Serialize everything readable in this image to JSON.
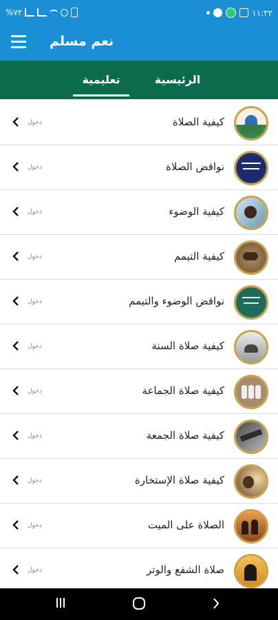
{
  "status_bar": {
    "time": "١١:٢٢",
    "battery": "%٧٢",
    "icons": [
      "image-icon",
      "whatsapp-icon",
      "phone-icon",
      "dot-icon",
      "battery-icon",
      "alarm-icon",
      "wifi-icon",
      "signal-icon",
      "signal-icon"
    ]
  },
  "app_bar": {
    "title": "نعم مسلم",
    "menu_icon": "hamburger-icon"
  },
  "tabs": [
    {
      "label": "الرئيسية",
      "active": false
    },
    {
      "label": "تعليمية",
      "active": true
    }
  ],
  "colors": {
    "app_bar": "#1b8fd6",
    "tab_bar": "#0c6b4d",
    "thumb_border": "#c9a24a"
  },
  "list": {
    "enter_label": "دخول",
    "items": [
      {
        "label": "كيفية الصلاة",
        "thumb": "mosque-thumb"
      },
      {
        "label": "نواقض الصلاة",
        "thumb": "calligraphy-thumb"
      },
      {
        "label": "كيفية الوضوء",
        "thumb": "wudu-thumb"
      },
      {
        "label": "كيفية التيمم",
        "thumb": "tayammum-thumb"
      },
      {
        "label": "نواقض الوضوء والتيمم",
        "thumb": "calligraphy-thumb"
      },
      {
        "label": "كيفية صلاة السنة",
        "thumb": "prayer-thumb"
      },
      {
        "label": "كيفية صلاة الجماعة",
        "thumb": "congregation-thumb"
      },
      {
        "label": "كيفية صلاة الجمعة",
        "thumb": "friday-thumb"
      },
      {
        "label": "كيفية صلاة الإستخارة",
        "thumb": "istikhara-thumb"
      },
      {
        "label": "الصلاة على الميت",
        "thumb": "funeral-thumb"
      },
      {
        "label": "صلاة الشفع والوتر",
        "thumb": "witr-thumb"
      }
    ]
  },
  "nav_bar": {
    "buttons": [
      "recents-icon",
      "home-icon",
      "back-icon"
    ]
  }
}
